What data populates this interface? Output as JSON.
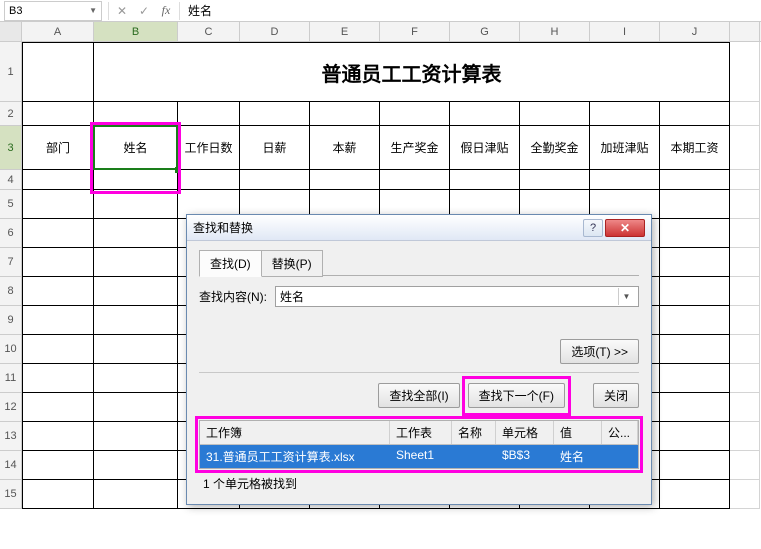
{
  "namebox": "B3",
  "formula_content": "姓名",
  "columns": [
    "A",
    "B",
    "C",
    "D",
    "E",
    "F",
    "G",
    "H",
    "I",
    "J"
  ],
  "rows": [
    "1",
    "2",
    "3",
    "4",
    "5",
    "6",
    "7",
    "8",
    "9",
    "10",
    "11",
    "12",
    "13",
    "14",
    "15"
  ],
  "title": "普通员工工资计算表",
  "headers": [
    "部门",
    "姓名",
    "工作日数",
    "日薪",
    "本薪",
    "生产奖金",
    "假日津贴",
    "全勤奖金",
    "加班津贴",
    "本期工资"
  ],
  "dialog": {
    "title": "查找和替换",
    "tab_find": "查找(D)",
    "tab_replace": "替换(P)",
    "find_label": "查找内容(N):",
    "find_value": "姓名",
    "options_btn": "选项(T) >>",
    "find_all_btn": "查找全部(I)",
    "find_next_btn": "查找下一个(F)",
    "close_btn": "关闭",
    "results": {
      "cols": {
        "workbook": "工作簿",
        "sheet": "工作表",
        "name": "名称",
        "cell": "单元格",
        "value": "值",
        "formula": "公..."
      },
      "row": {
        "workbook": "31.普通员工工资计算表.xlsx",
        "sheet": "Sheet1",
        "name": "",
        "cell": "$B$3",
        "value": "姓名",
        "formula": ""
      }
    },
    "status": "1 个单元格被找到"
  },
  "chart_data": {
    "type": "table",
    "title": "普通员工工资计算表",
    "columns": [
      "部门",
      "姓名",
      "工作日数",
      "日薪",
      "本薪",
      "生产奖金",
      "假日津贴",
      "全勤奖金",
      "加班津贴",
      "本期工资"
    ],
    "rows": []
  }
}
